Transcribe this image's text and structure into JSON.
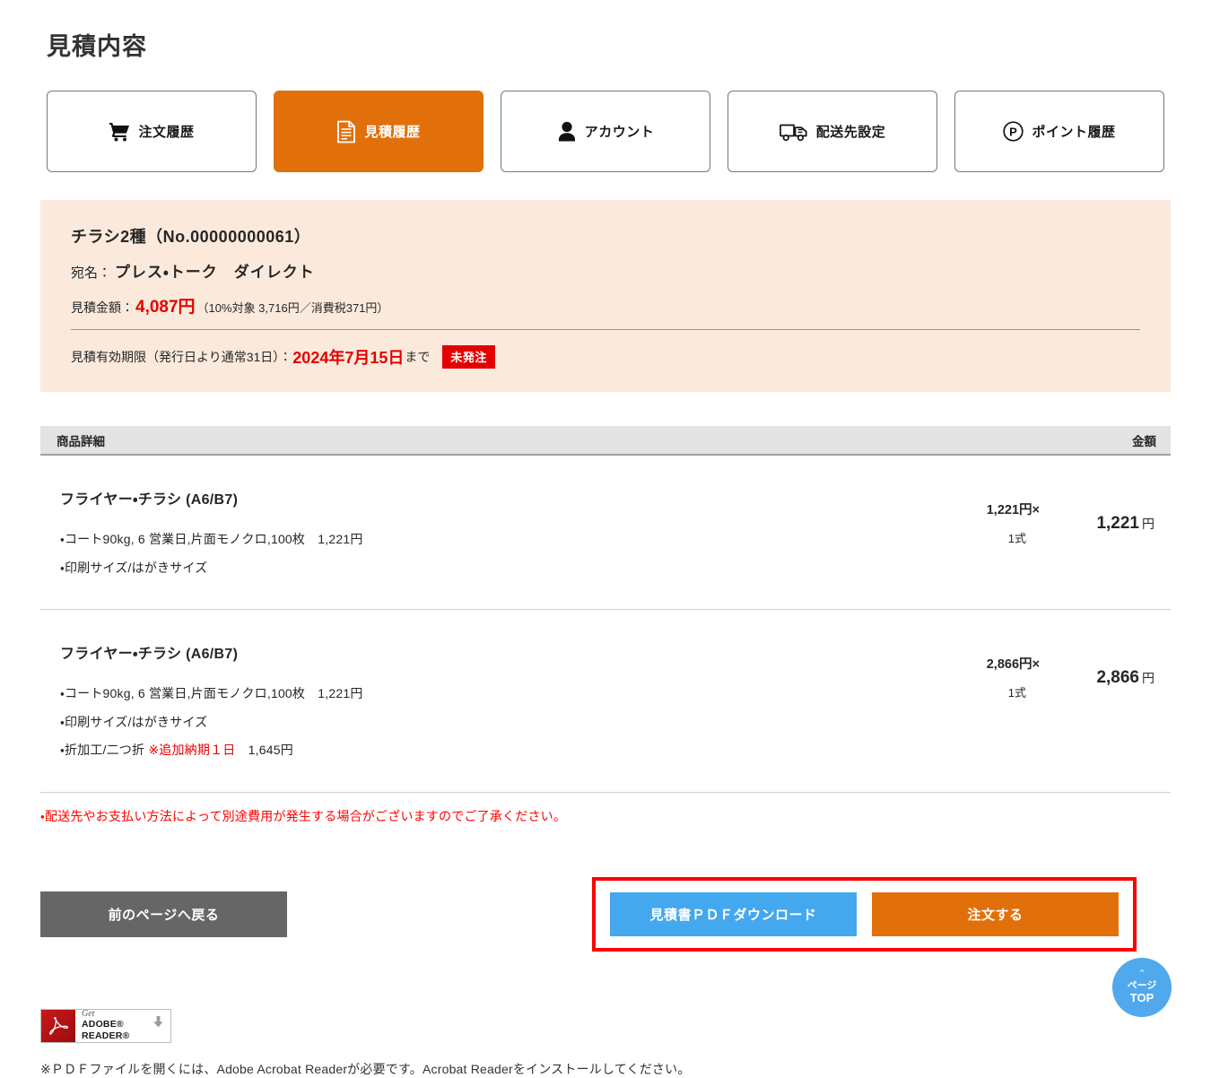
{
  "page": {
    "title": "見積内容"
  },
  "tabs": [
    {
      "label": "注文履歴",
      "icon": "cart-icon",
      "active": false
    },
    {
      "label": "見積履歴",
      "icon": "document-icon",
      "active": true
    },
    {
      "label": "アカウント",
      "icon": "person-icon",
      "active": false
    },
    {
      "label": "配送先設定",
      "icon": "truck-icon",
      "active": false
    },
    {
      "label": "ポイント履歴",
      "icon": "point-circle-icon",
      "active": false
    }
  ],
  "summary": {
    "title": "チラシ2種（No.00000000061）",
    "addressee_label": "宛名：",
    "addressee_value": "プレス・トーク　ダイレクト",
    "amount_label": "見積金額：",
    "amount_value": "4,087円",
    "amount_breakdown": "（10%対象 3,716円／消費税371円）",
    "validity_label": "見積有効期限（発行日より通常31日）：",
    "validity_date": "2024年7月15日",
    "validity_suffix": "まで",
    "status_badge": "未発注"
  },
  "table": {
    "header": {
      "detail": "商品詳細",
      "amount": "金額"
    },
    "rows": [
      {
        "name": "フライヤー・チラシ (A6/B7)",
        "specs": [
          {
            "text": "・コート90kg, 6 営業日,片面モノクロ,100枚　1,221円",
            "warn": ""
          },
          {
            "text": "・印刷サイズ/はがきサイズ",
            "warn": ""
          }
        ],
        "unit_price": "1,221円×",
        "quantity": "1式",
        "total_number": "1,221",
        "total_unit": "円"
      },
      {
        "name": "フライヤー・チラシ (A6/B7)",
        "specs": [
          {
            "text": "・コート90kg, 6 営業日,片面モノクロ,100枚　1,221円",
            "warn": ""
          },
          {
            "text": "・印刷サイズ/はがきサイズ",
            "warn": ""
          },
          {
            "text": "・折加工/二つ折 ",
            "warn": "※追加納期１日",
            "text_after": "　1,645円"
          }
        ],
        "unit_price": "2,866円×",
        "quantity": "1式",
        "total_number": "2,866",
        "total_unit": "円"
      }
    ]
  },
  "disclaimer": "・配送先やお支払い方法によって別途費用が発生する場合がございますのでご了承ください。",
  "actions": {
    "back_label": "前のページへ戻る",
    "pdf_label": "見積書ＰＤＦダウンロード",
    "order_label": "注文する"
  },
  "footer": {
    "adobe_get": "Get",
    "adobe_name": "ADOBE® READER®",
    "note": "※ＰＤＦファイルを開くには、Adobe Acrobat Readerが必要です。Acrobat Readerをインストールしてください。"
  },
  "pagetop": {
    "chevron": "⌃",
    "jp": "ページ",
    "en": "TOP"
  },
  "colors": {
    "accent_orange": "#E2700A",
    "summary_bg": "#FBEADC",
    "alert_red": "#E50000",
    "highlight_red": "#FF0000",
    "pdf_blue": "#44A8EE",
    "back_gray": "#666666",
    "pagetop_blue": "#4FA9EC"
  }
}
